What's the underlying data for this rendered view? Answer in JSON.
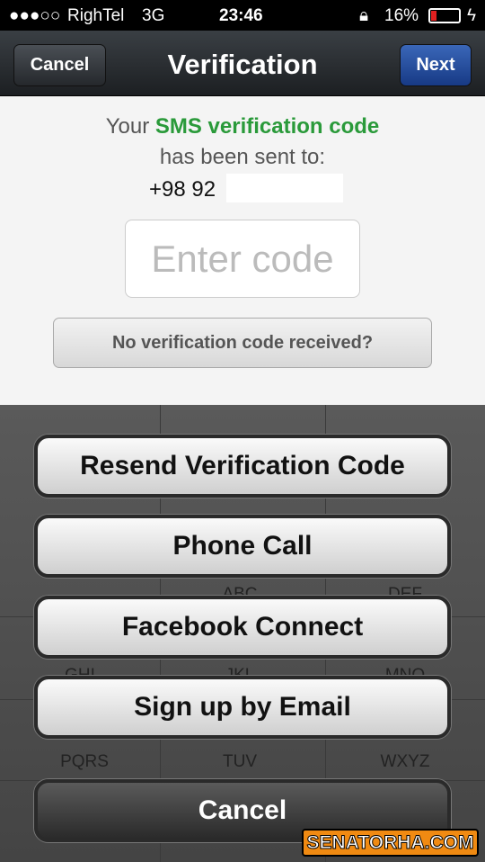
{
  "status": {
    "signal": "●●●○○",
    "carrier": "RighTel",
    "network": "3G",
    "time": "23:46",
    "battery": "16%"
  },
  "nav": {
    "cancel": "Cancel",
    "title": "Verification",
    "next": "Next"
  },
  "content": {
    "line1_pre": "Your ",
    "line1_green": "SMS verification code",
    "line2": "has been sent to:",
    "phone": "+98 92",
    "code_placeholder": "Enter code",
    "no_code": "No verification code received?"
  },
  "keypad": {
    "letters": [
      "ABC",
      "DEF",
      "GHI",
      "JKL",
      "MNO",
      "PQRS",
      "TUV",
      "WXYZ"
    ]
  },
  "sheet": {
    "resend": "Resend Verification Code",
    "phone_call": "Phone Call",
    "facebook": "Facebook Connect",
    "email": "Sign up by Email",
    "cancel": "Cancel"
  },
  "watermark": "SENATORHA.COM",
  "colors": {
    "accent_green": "#2a9a3a",
    "next_blue": "#1f4a9a"
  }
}
